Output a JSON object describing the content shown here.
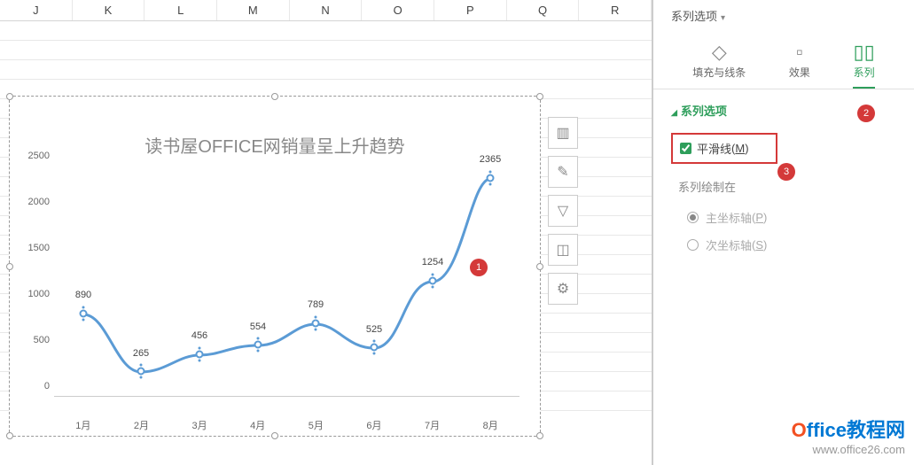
{
  "columns": [
    "J",
    "K",
    "L",
    "M",
    "N",
    "O",
    "P",
    "Q",
    "R"
  ],
  "chart_data": {
    "type": "line",
    "title": "读书屋OFFICE网销量呈上升趋势",
    "categories": [
      "1月",
      "2月",
      "3月",
      "4月",
      "5月",
      "6月",
      "7月",
      "8月"
    ],
    "values": [
      890,
      265,
      456,
      554,
      789,
      525,
      1254,
      2365
    ],
    "ylim": [
      0,
      2500
    ],
    "yticks": [
      0,
      500,
      1000,
      1500,
      2000,
      2500
    ],
    "smooth": true
  },
  "pane": {
    "header": "系列选项",
    "tabs": {
      "fill": "填充与线条",
      "effects": "效果",
      "series": "系列"
    },
    "section_title": "系列选项",
    "smooth_line": "平滑线",
    "smooth_line_key": "M",
    "plot_on": "系列绘制在",
    "primary_axis": "主坐标轴",
    "primary_axis_key": "P",
    "secondary_axis": "次坐标轴",
    "secondary_axis_key": "S"
  },
  "badges": {
    "b1": "1",
    "b2": "2",
    "b3": "3"
  },
  "watermark": {
    "brand_prefix": "O",
    "brand_rest": "ffice教程网",
    "url": "www.office26.com"
  }
}
